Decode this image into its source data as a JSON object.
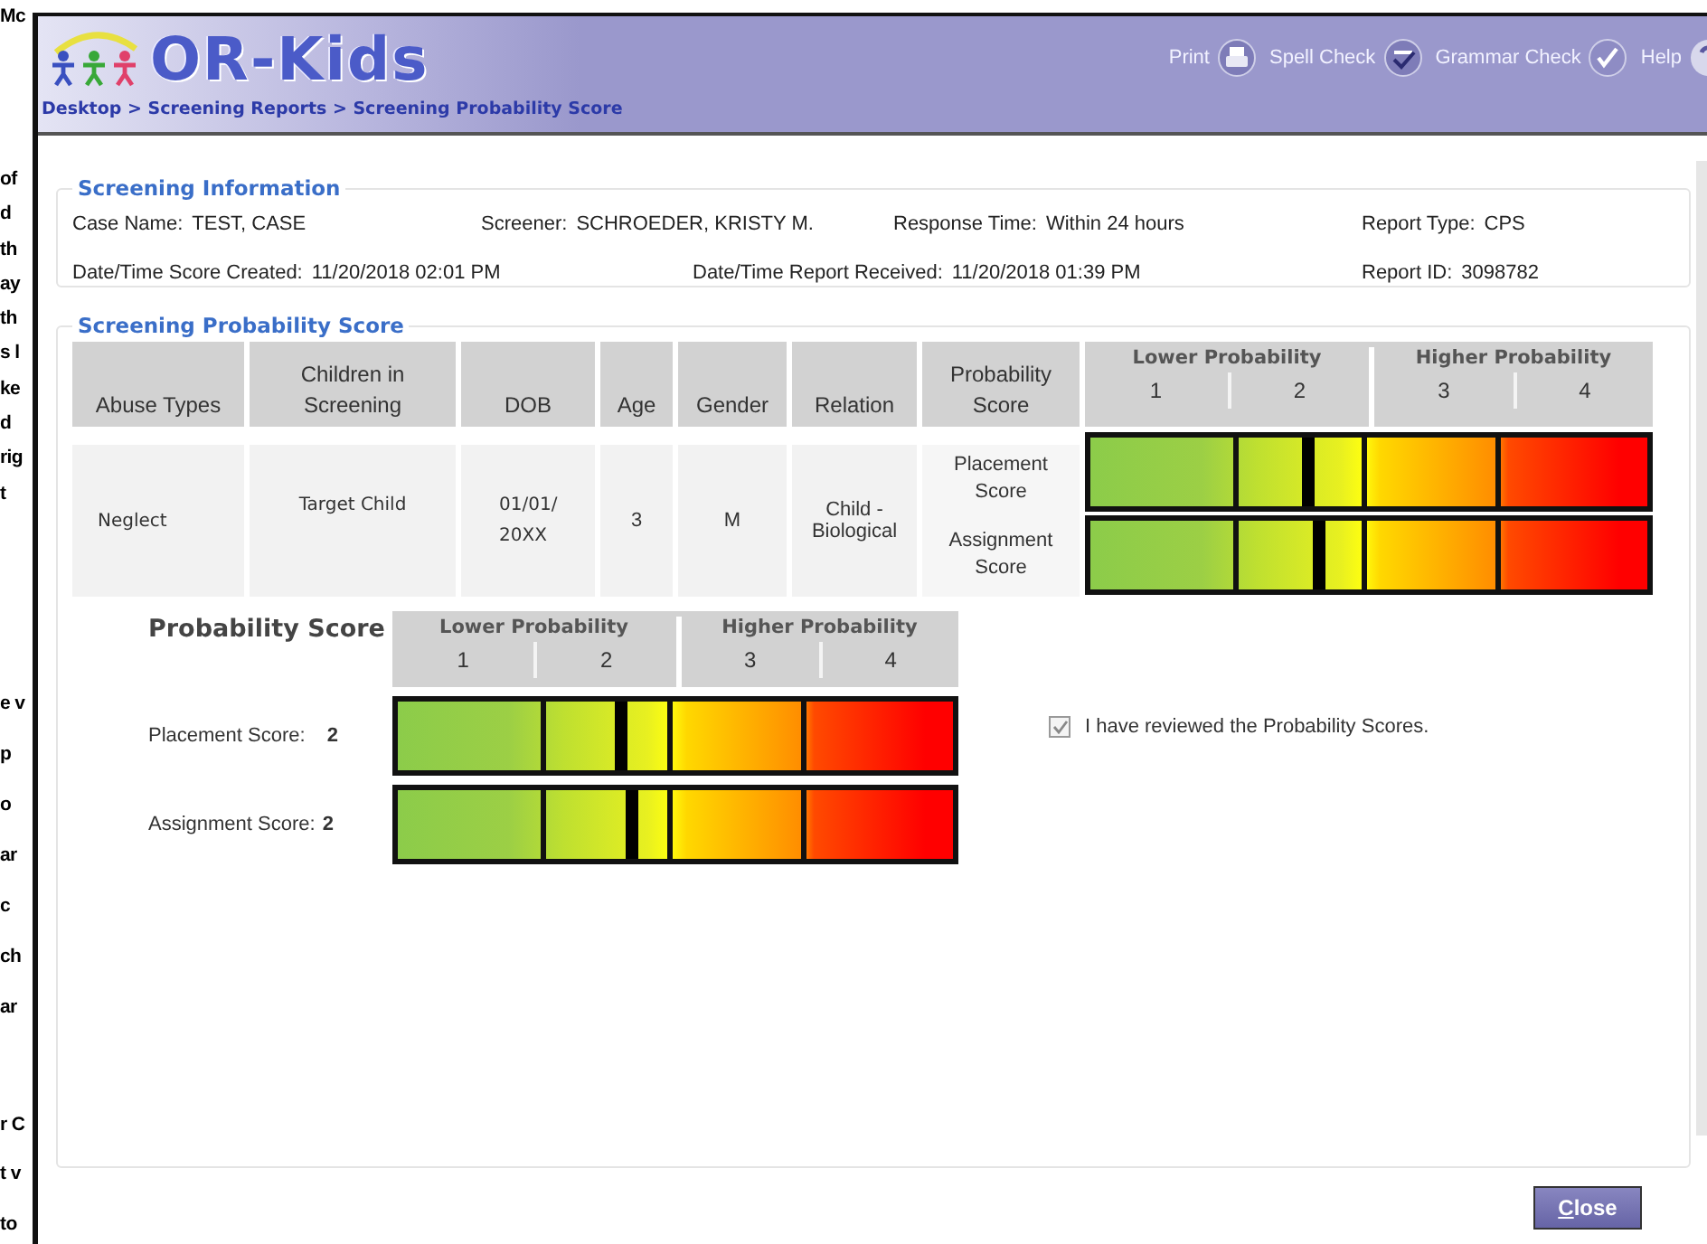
{
  "document_margin": {
    "paragraphs": [
      [
        "Mc"
      ],
      [
        "of",
        "d",
        "th",
        "ay",
        "th",
        "s l",
        "ke",
        "d",
        "rig",
        "t"
      ],
      [
        "e v",
        "p",
        "o",
        "ar",
        "c",
        "ch",
        "ar"
      ],
      [
        "r C",
        "t v",
        "to"
      ]
    ]
  },
  "header": {
    "logo": "OR-Kids",
    "breadcrumb": "Desktop > Screening Reports > Screening Probability Score",
    "tools": [
      {
        "label": "Print",
        "kind": "print"
      },
      {
        "label": "Spell Check",
        "kind": "spell"
      },
      {
        "label": "Grammar Check",
        "kind": "grammar"
      },
      {
        "label": "Help",
        "kind": "help"
      }
    ]
  },
  "screening_information": {
    "title": "Screening Information",
    "lines": [
      {
        "fields": [
          {
            "label": "Case Name:",
            "value": "TEST, CASE"
          },
          {
            "label": "Screener:",
            "value": "SCHROEDER, KRISTY M."
          },
          {
            "label": "Response Time:",
            "value": "Within 24 hours"
          },
          {
            "label": "Report Type:",
            "value": "CPS"
          }
        ]
      },
      {
        "fields": [
          {
            "label": "Date/Time Score Created:",
            "value": "11/20/2018 02:01 PM"
          },
          {
            "label": "Date/Time Report Received:",
            "value": "11/20/2018 01:39 PM"
          },
          {
            "label": "Report ID:",
            "value": "3098782"
          }
        ]
      }
    ]
  },
  "probability_score": {
    "title": "Screening Probability Score",
    "columns": [
      "Abuse Types",
      "Children in Screening",
      "DOB",
      "Age",
      "Gender",
      "Relation",
      "Probability Score"
    ],
    "scale": {
      "groups": [
        "Lower Probability",
        "Higher Probability"
      ],
      "ticks": [
        "1",
        "2",
        "3",
        "4"
      ]
    },
    "row": {
      "cells": [
        "Neglect",
        "Target Child",
        "01/01/20XX",
        "3",
        "M",
        "Child - Biological"
      ],
      "scores": [
        {
          "label": "Placement Score",
          "level": 0.39
        },
        {
          "label": "Assignment Score",
          "level": 0.41
        }
      ]
    },
    "summary": {
      "title": "Probability Score",
      "scale": {
        "groups": [
          "Lower Probability",
          "Higher Probability"
        ],
        "ticks": [
          "1",
          "2",
          "3",
          "4"
        ]
      },
      "scores": [
        {
          "label": "Placement Score:",
          "value": "2",
          "level": 0.4
        },
        {
          "label": "Assignment Score:",
          "value": "2",
          "level": 0.42
        }
      ]
    },
    "review": {
      "label": "I have reviewed the Probability Scores.",
      "checked": true
    }
  },
  "buttons": [
    "Close"
  ]
}
